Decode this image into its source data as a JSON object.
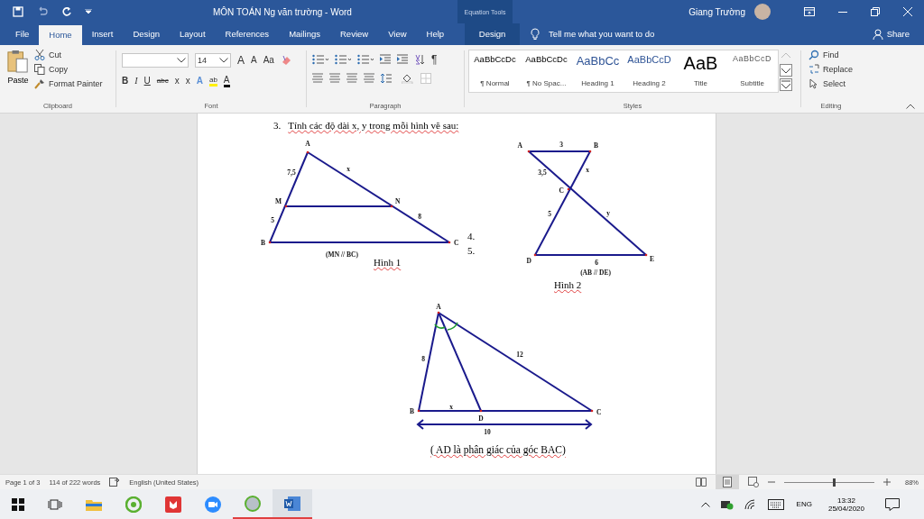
{
  "window": {
    "title": "MÔN TOÁN  Ng văn trường  -  Word",
    "context_group": "Equation Tools",
    "user": "Giang Trường"
  },
  "tabs": [
    {
      "label": "File",
      "selected": false,
      "kind": "normal"
    },
    {
      "label": "Home",
      "selected": true,
      "kind": "normal"
    },
    {
      "label": "Insert",
      "selected": false,
      "kind": "normal"
    },
    {
      "label": "Design",
      "selected": false,
      "kind": "normal"
    },
    {
      "label": "Layout",
      "selected": false,
      "kind": "normal"
    },
    {
      "label": "References",
      "selected": false,
      "kind": "normal"
    },
    {
      "label": "Mailings",
      "selected": false,
      "kind": "normal"
    },
    {
      "label": "Review",
      "selected": false,
      "kind": "normal"
    },
    {
      "label": "View",
      "selected": false,
      "kind": "normal"
    },
    {
      "label": "Help",
      "selected": false,
      "kind": "normal"
    },
    {
      "label": "Design",
      "selected": false,
      "kind": "contextual"
    }
  ],
  "tell_me": {
    "placeholder": "Tell me what you want to do"
  },
  "share": "Share",
  "clipboard": {
    "paste": "Paste",
    "cut": "Cut",
    "copy": "Copy",
    "format_painter": "Format Painter",
    "label": "Clipboard"
  },
  "font": {
    "size": "14",
    "grow": "A",
    "shrink": "A",
    "change_case": "Aa",
    "bold": "B",
    "italic": "I",
    "underline": "U",
    "strikethrough": "abc",
    "subscript": "x",
    "superscript": "x",
    "effects": "A",
    "highlight": "ab",
    "text_color": "A",
    "label": "Font"
  },
  "paragraph": {
    "show_marks": "¶",
    "label": "Paragraph"
  },
  "styles": {
    "items": [
      {
        "preview": "AaBbCcDc",
        "name": "¶ Normal",
        "kind": "normal"
      },
      {
        "preview": "AaBbCcDc",
        "name": "¶ No Spac...",
        "kind": "normal"
      },
      {
        "preview": "AaBbCc",
        "name": "Heading 1",
        "kind": "heading1"
      },
      {
        "preview": "AaBbCcD",
        "name": "Heading 2",
        "kind": "heading2"
      },
      {
        "preview": "AaB",
        "name": "Title",
        "kind": "title"
      },
      {
        "preview": "AaBbCcD",
        "name": "Subtitle",
        "kind": "subtitle"
      }
    ],
    "label": "Styles"
  },
  "editing": {
    "find": "Find",
    "replace": "Replace",
    "select": "Select",
    "label": "Editing"
  },
  "document": {
    "question": {
      "number": "3.",
      "text": "Tính các độ dài x, y  trong mỗi hình vẽ sau:"
    },
    "empty_items": [
      "4.",
      "5."
    ],
    "figures": [
      {
        "points": [
          "A",
          "M",
          "B",
          "N",
          "C"
        ],
        "lengths": [
          "7,5",
          "x",
          "5",
          "8"
        ],
        "note": "(MN // BC)",
        "caption": "Hình 1"
      },
      {
        "points": [
          "A",
          "B",
          "C",
          "D",
          "E"
        ],
        "lengths": [
          "3",
          "3,5",
          "x",
          "5",
          "y",
          "6"
        ],
        "note": "(AB // DE)",
        "caption": "Hình 2"
      },
      {
        "points": [
          "A",
          "B",
          "D",
          "C"
        ],
        "lengths": [
          "8",
          "12",
          "x",
          "10"
        ],
        "caption": "( AD là phân giác của góc BAC)"
      }
    ]
  },
  "status_bar": {
    "page": "Page 1 of 3",
    "words": "114 of 222 words",
    "language": "English (United States)",
    "zoom": "88%",
    "zoom_slider": {
      "level": 0.55
    }
  },
  "taskbar": {
    "language": "ENG",
    "time": "13:32",
    "date": "25/04/2020"
  }
}
